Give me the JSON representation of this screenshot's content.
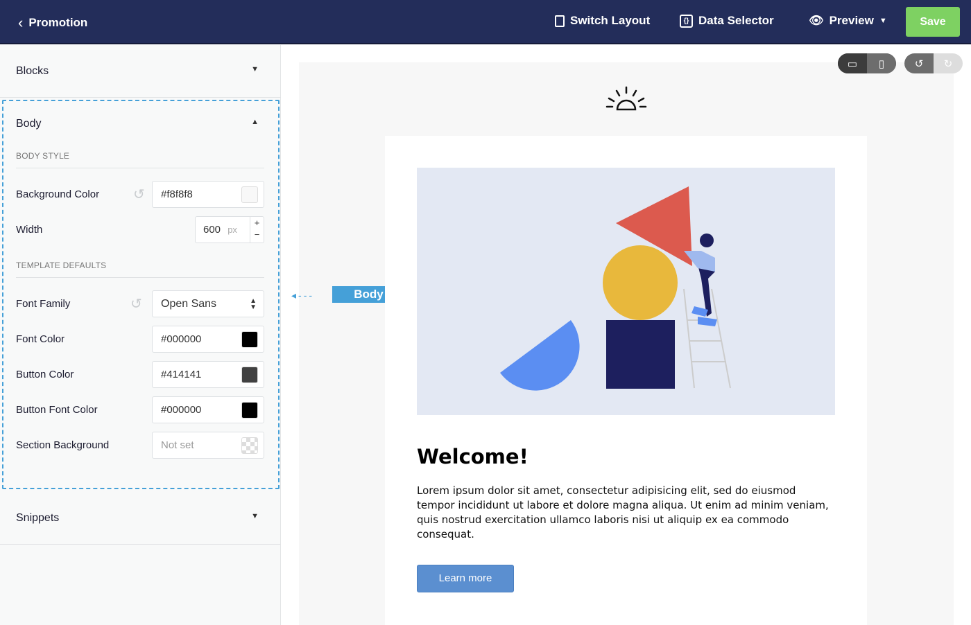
{
  "header": {
    "back_label": "Promotion",
    "switch_layout": "Switch Layout",
    "data_selector": "Data Selector",
    "preview": "Preview",
    "save": "Save"
  },
  "sidebar": {
    "blocks": "Blocks",
    "body": "Body",
    "body_style": "BODY STYLE",
    "template_defaults": "TEMPLATE DEFAULTS",
    "snippets": "Snippets",
    "bg_color_label": "Background Color",
    "bg_color": "#f8f8f8",
    "width_label": "Width",
    "width_value": "600",
    "width_unit": "px",
    "font_family_label": "Font Family",
    "font_family": "Open Sans",
    "font_color_label": "Font Color",
    "font_color": "#000000",
    "button_color_label": "Button Color",
    "button_color": "#414141",
    "button_font_color_label": "Button Font Color",
    "button_font_color": "#000000",
    "section_bg_label": "Section Background",
    "section_bg": "Not set"
  },
  "canvas": {
    "body_tag": "Body",
    "heading": "Welcome!",
    "paragraph": "Lorem ipsum dolor sit amet, consectetur adipisicing elit, sed do eiusmod tempor incididunt ut labore et dolore magna aliqua. Ut enim ad minim veniam, quis nostrud exercitation ullamco laboris nisi ut aliquip ex ea commodo consequat.",
    "button": "Learn more"
  },
  "colors": {
    "accent": "#45a0d8",
    "save": "#7ed162",
    "header": "#232d5a",
    "button": "#5b8fd0"
  }
}
